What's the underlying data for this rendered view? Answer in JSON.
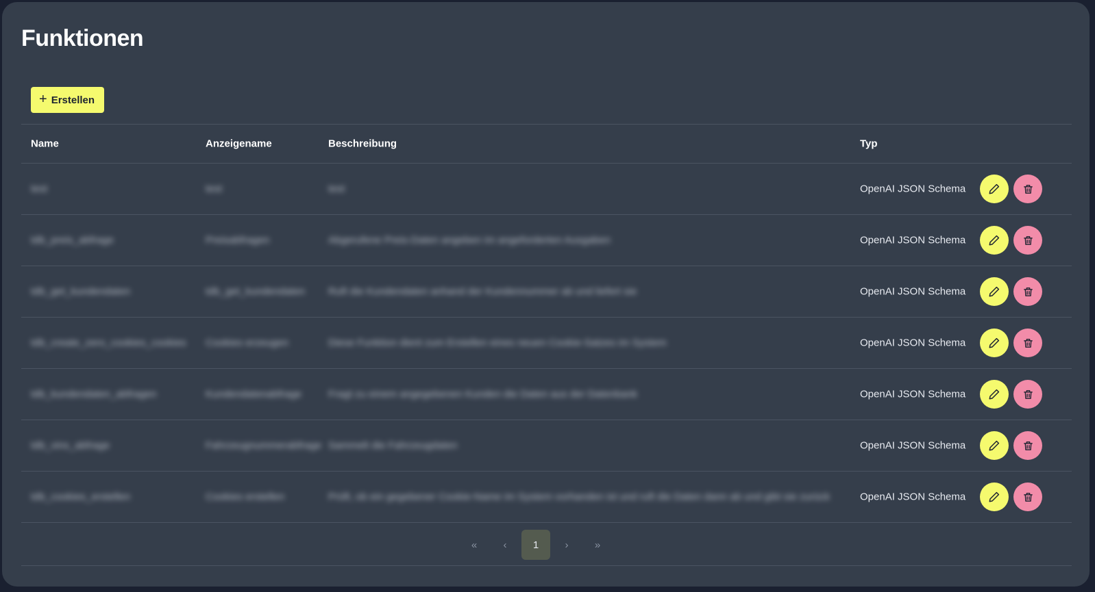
{
  "page": {
    "title": "Funktionen"
  },
  "toolbar": {
    "create_label": "Erstellen"
  },
  "table": {
    "headers": {
      "name": "Name",
      "display_name": "Anzeigename",
      "description": "Beschreibung",
      "type": "Typ"
    },
    "rows": [
      {
        "name": "test",
        "display_name": "test",
        "description": "test",
        "type": "OpenAI JSON Schema"
      },
      {
        "name": "tdb_preis_abfrage",
        "display_name": "Preisabfragen",
        "description": "Abgerufene Preis-Daten angeben im angeforderten Ausgaben",
        "type": "OpenAI JSON Schema"
      },
      {
        "name": "tdb_get_kundendaten",
        "display_name": "tdb_get_kundendaten",
        "description": "Ruft die Kundendaten anhand der Kundennummer ab und liefert sie",
        "type": "OpenAI JSON Schema"
      },
      {
        "name": "tdb_create_zero_cookies_cookies",
        "display_name": "Cookies erzeugen",
        "description": "Diese Funktion dient zum Erstellen eines neuen Cookie-Satzes im System",
        "type": "OpenAI JSON Schema"
      },
      {
        "name": "tdb_kundendaten_abfragen",
        "display_name": "Kundendatenabfrage",
        "description": "Fragt zu einem angegebenen Kunden die Daten aus der Datenbank",
        "type": "OpenAI JSON Schema"
      },
      {
        "name": "tdb_vins_abfrage",
        "display_name": "Fahrzeugnummerabfrage",
        "description": "Sammelt die Fahrzeugdaten",
        "type": "OpenAI JSON Schema"
      },
      {
        "name": "tdb_cookies_erstellen",
        "display_name": "Cookies erstellen",
        "description": "Prüft, ob ein gegebener Cookie-Name im System vorhanden ist und ruft die Daten dann ab und gibt sie zurück",
        "type": "OpenAI JSON Schema"
      }
    ]
  },
  "pagination": {
    "first": "«",
    "prev": "‹",
    "current": "1",
    "next": "›",
    "last": "»"
  },
  "colors": {
    "accent": "#f5fa6e",
    "danger": "#f28ca9",
    "panel": "#353e4b",
    "background": "#1a2030"
  },
  "icons": {
    "edit": "pencil-icon",
    "delete": "trash-icon",
    "create": "plus-icon"
  }
}
